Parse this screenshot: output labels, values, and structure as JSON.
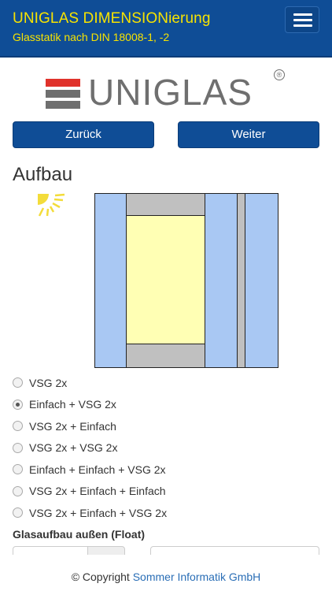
{
  "header": {
    "title": "UNIGLAS DIMENSIONierung",
    "subtitle": "Glasstatik nach DIN 18008-1, -2",
    "menu_icon": "hamburger-icon"
  },
  "logo": {
    "text": "UNIGLAS",
    "registered": "®",
    "stripe_colors": [
      "#e0322b",
      "#6f6f6f",
      "#6f6f6f"
    ]
  },
  "nav": {
    "back_label": "Zurück",
    "next_label": "Weiter"
  },
  "section": {
    "title": "Aufbau"
  },
  "diagram": {
    "icon": "sun-icon",
    "colors": {
      "glass": "#a9c8f3",
      "interlayer": "#ffffb4",
      "spacer": "#c0c0c0",
      "sun": "#f3dc3a"
    }
  },
  "options": [
    {
      "label": "VSG 2x",
      "checked": false
    },
    {
      "label": "Einfach + VSG 2x",
      "checked": true
    },
    {
      "label": "VSG 2x + Einfach",
      "checked": false
    },
    {
      "label": "VSG 2x + VSG 2x",
      "checked": false
    },
    {
      "label": "Einfach + Einfach + VSG 2x",
      "checked": false
    },
    {
      "label": "VSG 2x + Einfach + Einfach",
      "checked": false
    },
    {
      "label": "VSG 2x + Einfach + VSG 2x",
      "checked": false
    }
  ],
  "glass_outer": {
    "label": "Glasaufbau außen (Float)",
    "thickness_value": "",
    "type_value": ""
  },
  "footer": {
    "copyright": "© Copyright",
    "company": "Sommer Informatik GmbH"
  },
  "colors": {
    "brand_blue": "#0f4d96",
    "header_text": "#f7e300",
    "link": "#2a6eb6"
  }
}
